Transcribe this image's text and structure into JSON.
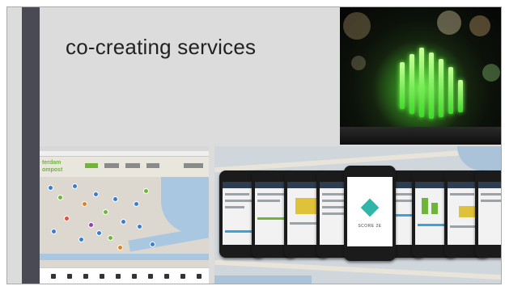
{
  "slide": {
    "title": "co-creating services"
  },
  "images": {
    "photo": {
      "icon": "green-glow-sculpture-image"
    },
    "browser": {
      "icon": "city-map-website-image",
      "logo_line1": "terdam",
      "logo_line2": "ompost"
    },
    "phones": {
      "icon": "mobile-app-screens-image",
      "app_label": "SCORE 2E"
    }
  },
  "colors": {
    "slide_background": "#dcdcdc",
    "accent_bar": "#4a4a55",
    "title_text": "#222222",
    "glow_green": "#3fdc2a"
  }
}
